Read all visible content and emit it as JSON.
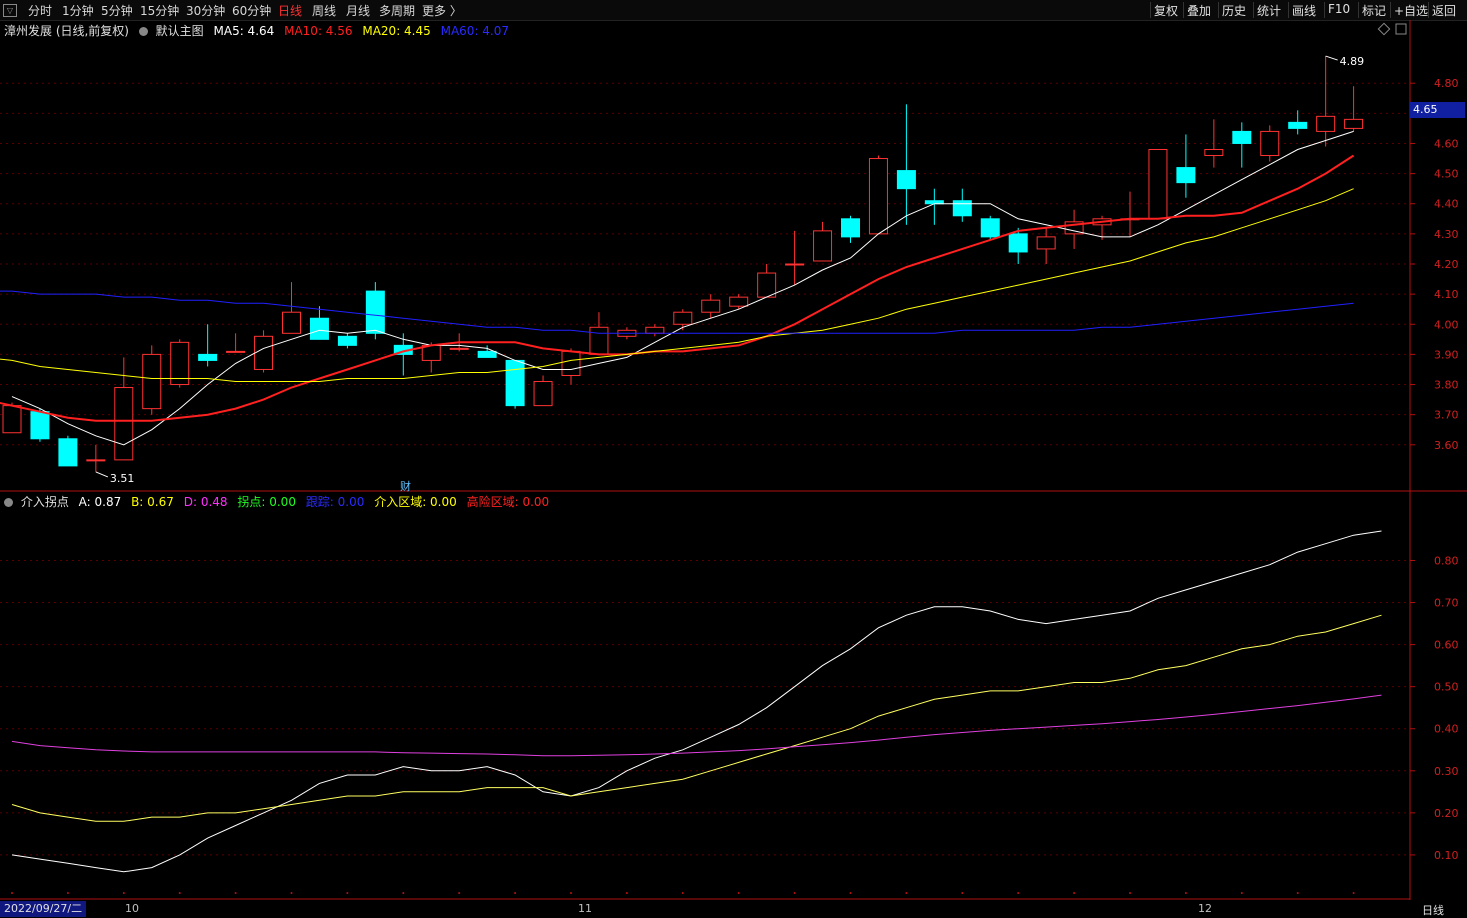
{
  "toolbar": {
    "logo": "▽",
    "periods": [
      "分时",
      "1分钟",
      "5分钟",
      "15分钟",
      "30分钟",
      "60分钟",
      "日线",
      "周线",
      "月线",
      "多周期",
      "更多 〉"
    ],
    "active_period": "日线",
    "right_buttons": [
      "复权",
      "叠加",
      "历史",
      "统计",
      "画线",
      "F10",
      "标记",
      "+自选",
      "返回"
    ]
  },
  "main_legend": {
    "stock": "漳州发展 (日线,前复权)",
    "indicator": "默认主图",
    "ma5": "MA5: 4.64",
    "ma10": "MA10: 4.56",
    "ma20": "MA20: 4.45",
    "ma60": "MA60: 4.07"
  },
  "sub_legend": {
    "name": "介入拐点",
    "a": "A: 0.87",
    "b": "B: 0.67",
    "d": "D: 0.48",
    "turn": "拐点: 0.00",
    "track": "跟踪: 0.00",
    "entry": "介入区域: 0.00",
    "risk": "高险区域: 0.00"
  },
  "annotations": {
    "high_label": "4.89",
    "low_label": "3.51",
    "current_price": "4.65",
    "finance_marker": "财"
  },
  "date_axis": {
    "start": "2022/09/27/二",
    "months": [
      "10",
      "11",
      "12"
    ],
    "period_label": "日线"
  },
  "colors": {
    "up": "#ff3232",
    "down": "#00ffff",
    "ma5": "#ffffff",
    "ma10": "#ff2020",
    "ma20": "#ffff00",
    "ma60": "#2020ff",
    "grid": "#5a0000",
    "axis": "#b01010"
  },
  "chart_data": [
    {
      "type": "candlestick",
      "title": "漳州发展 (日线,前复权)",
      "ylim": [
        3.45,
        4.95
      ],
      "yticks": [
        3.6,
        3.7,
        3.8,
        3.9,
        4.0,
        4.1,
        4.2,
        4.3,
        4.4,
        4.5,
        4.6,
        4.7,
        4.8
      ],
      "candles": [
        {
          "o": 3.64,
          "h": 3.74,
          "l": 3.64,
          "c": 3.73
        },
        {
          "o": 3.71,
          "h": 3.72,
          "l": 3.61,
          "c": 3.62
        },
        {
          "o": 3.62,
          "h": 3.63,
          "l": 3.53,
          "c": 3.53
        },
        {
          "o": 3.55,
          "h": 3.6,
          "l": 3.51,
          "c": 3.55
        },
        {
          "o": 3.55,
          "h": 3.89,
          "l": 3.55,
          "c": 3.79
        },
        {
          "o": 3.72,
          "h": 3.93,
          "l": 3.7,
          "c": 3.9
        },
        {
          "o": 3.8,
          "h": 3.95,
          "l": 3.79,
          "c": 3.94
        },
        {
          "o": 3.9,
          "h": 4.0,
          "l": 3.86,
          "c": 3.88
        },
        {
          "o": 3.91,
          "h": 3.97,
          "l": 3.91,
          "c": 3.91
        },
        {
          "o": 3.85,
          "h": 3.98,
          "l": 3.84,
          "c": 3.96
        },
        {
          "o": 3.97,
          "h": 4.14,
          "l": 3.97,
          "c": 4.04
        },
        {
          "o": 4.02,
          "h": 4.06,
          "l": 3.95,
          "c": 3.95
        },
        {
          "o": 3.96,
          "h": 3.97,
          "l": 3.92,
          "c": 3.93
        },
        {
          "o": 4.11,
          "h": 4.14,
          "l": 3.95,
          "c": 3.97
        },
        {
          "o": 3.93,
          "h": 3.97,
          "l": 3.83,
          "c": 3.9
        },
        {
          "o": 3.88,
          "h": 3.94,
          "l": 3.84,
          "c": 3.93
        },
        {
          "o": 3.92,
          "h": 3.97,
          "l": 3.91,
          "c": 3.92
        },
        {
          "o": 3.91,
          "h": 3.93,
          "l": 3.89,
          "c": 3.89
        },
        {
          "o": 3.88,
          "h": 3.88,
          "l": 3.72,
          "c": 3.73
        },
        {
          "o": 3.73,
          "h": 3.83,
          "l": 3.73,
          "c": 3.81
        },
        {
          "o": 3.83,
          "h": 3.92,
          "l": 3.8,
          "c": 3.91
        },
        {
          "o": 3.9,
          "h": 4.04,
          "l": 3.9,
          "c": 3.99
        },
        {
          "o": 3.96,
          "h": 3.99,
          "l": 3.95,
          "c": 3.98
        },
        {
          "o": 3.97,
          "h": 4.0,
          "l": 3.96,
          "c": 3.99
        },
        {
          "o": 4.0,
          "h": 4.05,
          "l": 3.98,
          "c": 4.04
        },
        {
          "o": 4.04,
          "h": 4.1,
          "l": 4.02,
          "c": 4.08
        },
        {
          "o": 4.06,
          "h": 4.1,
          "l": 4.05,
          "c": 4.09
        },
        {
          "o": 4.09,
          "h": 4.2,
          "l": 4.09,
          "c": 4.17
        },
        {
          "o": 4.2,
          "h": 4.31,
          "l": 4.13,
          "c": 4.2
        },
        {
          "o": 4.21,
          "h": 4.34,
          "l": 4.21,
          "c": 4.31
        },
        {
          "o": 4.35,
          "h": 4.36,
          "l": 4.27,
          "c": 4.29
        },
        {
          "o": 4.3,
          "h": 4.56,
          "l": 4.3,
          "c": 4.55
        },
        {
          "o": 4.51,
          "h": 4.73,
          "l": 4.33,
          "c": 4.45
        },
        {
          "o": 4.41,
          "h": 4.45,
          "l": 4.33,
          "c": 4.4
        },
        {
          "o": 4.41,
          "h": 4.45,
          "l": 4.34,
          "c": 4.36
        },
        {
          "o": 4.35,
          "h": 4.36,
          "l": 4.28,
          "c": 4.29
        },
        {
          "o": 4.3,
          "h": 4.32,
          "l": 4.2,
          "c": 4.24
        },
        {
          "o": 4.25,
          "h": 4.32,
          "l": 4.2,
          "c": 4.29
        },
        {
          "o": 4.3,
          "h": 4.38,
          "l": 4.25,
          "c": 4.34
        },
        {
          "o": 4.33,
          "h": 4.36,
          "l": 4.28,
          "c": 4.35
        },
        {
          "o": 4.35,
          "h": 4.44,
          "l": 4.29,
          "c": 4.35
        },
        {
          "o": 4.35,
          "h": 4.58,
          "l": 4.35,
          "c": 4.58
        },
        {
          "o": 4.52,
          "h": 4.63,
          "l": 4.42,
          "c": 4.47
        },
        {
          "o": 4.56,
          "h": 4.68,
          "l": 4.52,
          "c": 4.58
        },
        {
          "o": 4.64,
          "h": 4.67,
          "l": 4.52,
          "c": 4.6
        },
        {
          "o": 4.56,
          "h": 4.66,
          "l": 4.54,
          "c": 4.64
        },
        {
          "o": 4.67,
          "h": 4.71,
          "l": 4.63,
          "c": 4.65
        },
        {
          "o": 4.64,
          "h": 4.89,
          "l": 4.59,
          "c": 4.69
        },
        {
          "o": 4.65,
          "h": 4.79,
          "l": 4.64,
          "c": 4.68
        }
      ],
      "series": [
        {
          "name": "MA5",
          "values": [
            3.76,
            3.72,
            3.67,
            3.63,
            3.6,
            3.65,
            3.72,
            3.8,
            3.87,
            3.92,
            3.95,
            3.98,
            3.97,
            3.98,
            3.95,
            3.93,
            3.93,
            3.92,
            3.88,
            3.85,
            3.85,
            3.87,
            3.89,
            3.94,
            3.99,
            4.02,
            4.05,
            4.09,
            4.13,
            4.18,
            4.22,
            4.3,
            4.36,
            4.4,
            4.4,
            4.4,
            4.35,
            4.33,
            4.31,
            4.29,
            4.29,
            4.33,
            4.38,
            4.43,
            4.48,
            4.53,
            4.58,
            4.61,
            4.64
          ]
        },
        {
          "name": "MA10",
          "values": [
            3.75,
            3.73,
            3.71,
            3.69,
            3.68,
            3.68,
            3.68,
            3.69,
            3.7,
            3.72,
            3.75,
            3.79,
            3.82,
            3.85,
            3.88,
            3.91,
            3.93,
            3.94,
            3.94,
            3.94,
            3.92,
            3.91,
            3.9,
            3.9,
            3.91,
            3.91,
            3.92,
            3.93,
            3.96,
            4.0,
            4.05,
            4.1,
            4.15,
            4.19,
            4.22,
            4.25,
            4.28,
            4.31,
            4.32,
            4.33,
            4.34,
            4.35,
            4.35,
            4.36,
            4.36,
            4.37,
            4.41,
            4.45,
            4.5,
            4.56
          ]
        },
        {
          "name": "MA20",
          "values": [
            3.89,
            3.88,
            3.86,
            3.85,
            3.84,
            3.83,
            3.82,
            3.82,
            3.82,
            3.81,
            3.81,
            3.81,
            3.81,
            3.82,
            3.82,
            3.82,
            3.83,
            3.84,
            3.84,
            3.85,
            3.86,
            3.88,
            3.89,
            3.9,
            3.91,
            3.92,
            3.93,
            3.94,
            3.96,
            3.97,
            3.98,
            4.0,
            4.02,
            4.05,
            4.07,
            4.09,
            4.11,
            4.13,
            4.15,
            4.17,
            4.19,
            4.21,
            4.24,
            4.27,
            4.29,
            4.32,
            4.35,
            4.38,
            4.41,
            4.45
          ]
        },
        {
          "name": "MA60",
          "values": [
            4.11,
            4.11,
            4.1,
            4.1,
            4.1,
            4.09,
            4.09,
            4.08,
            4.08,
            4.07,
            4.07,
            4.06,
            4.05,
            4.04,
            4.03,
            4.02,
            4.01,
            4.0,
            3.99,
            3.99,
            3.98,
            3.98,
            3.97,
            3.97,
            3.97,
            3.97,
            3.97,
            3.97,
            3.97,
            3.97,
            3.97,
            3.97,
            3.97,
            3.97,
            3.97,
            3.98,
            3.98,
            3.98,
            3.98,
            3.98,
            3.99,
            3.99,
            4.0,
            4.01,
            4.02,
            4.03,
            4.04,
            4.05,
            4.06,
            4.07
          ]
        }
      ]
    },
    {
      "type": "line",
      "title": "介入拐点",
      "ylim": [
        0.0,
        0.92
      ],
      "yticks": [
        0.1,
        0.2,
        0.3,
        0.4,
        0.5,
        0.6,
        0.7,
        0.8
      ],
      "series": [
        {
          "name": "A",
          "values": [
            0.1,
            0.09,
            0.08,
            0.07,
            0.06,
            0.07,
            0.1,
            0.14,
            0.17,
            0.2,
            0.23,
            0.27,
            0.29,
            0.29,
            0.31,
            0.3,
            0.3,
            0.31,
            0.29,
            0.25,
            0.24,
            0.26,
            0.3,
            0.33,
            0.35,
            0.38,
            0.41,
            0.45,
            0.5,
            0.55,
            0.59,
            0.64,
            0.67,
            0.69,
            0.69,
            0.68,
            0.66,
            0.65,
            0.66,
            0.67,
            0.68,
            0.71,
            0.73,
            0.75,
            0.77,
            0.79,
            0.82,
            0.84,
            0.86,
            0.87
          ]
        },
        {
          "name": "B",
          "values": [
            0.22,
            0.2,
            0.19,
            0.18,
            0.18,
            0.19,
            0.19,
            0.2,
            0.2,
            0.21,
            0.22,
            0.23,
            0.24,
            0.24,
            0.25,
            0.25,
            0.25,
            0.26,
            0.26,
            0.26,
            0.24,
            0.25,
            0.26,
            0.27,
            0.28,
            0.3,
            0.32,
            0.34,
            0.36,
            0.38,
            0.4,
            0.43,
            0.45,
            0.47,
            0.48,
            0.49,
            0.49,
            0.5,
            0.51,
            0.51,
            0.52,
            0.54,
            0.55,
            0.57,
            0.59,
            0.6,
            0.62,
            0.63,
            0.65,
            0.67
          ]
        },
        {
          "name": "D",
          "values": [
            0.37,
            0.36,
            0.355,
            0.35,
            0.347,
            0.345,
            0.345,
            0.345,
            0.345,
            0.345,
            0.345,
            0.345,
            0.345,
            0.345,
            0.343,
            0.342,
            0.341,
            0.34,
            0.338,
            0.336,
            0.336,
            0.337,
            0.338,
            0.34,
            0.342,
            0.345,
            0.348,
            0.352,
            0.357,
            0.362,
            0.367,
            0.373,
            0.38,
            0.386,
            0.391,
            0.396,
            0.4,
            0.404,
            0.408,
            0.412,
            0.417,
            0.422,
            0.428,
            0.434,
            0.441,
            0.448,
            0.455,
            0.463,
            0.471,
            0.48
          ]
        }
      ]
    }
  ]
}
